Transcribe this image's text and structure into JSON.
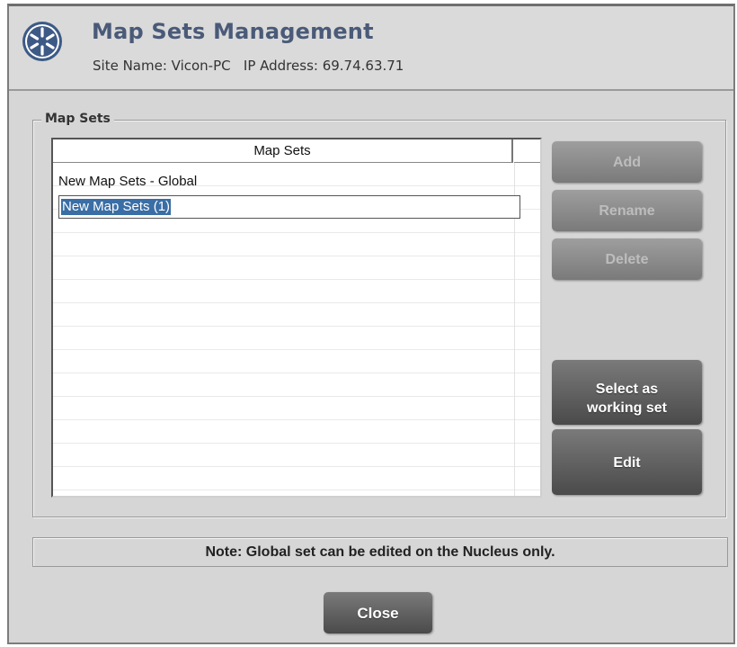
{
  "header": {
    "title": "Map Sets Management",
    "site_info": "Site Name: Vicon-PC   IP Address: 69.74.63.71",
    "logo_icon": "vicon-logo-icon"
  },
  "map_sets_group": {
    "legend": "Map Sets",
    "list": {
      "column_header": "Map Sets",
      "items": [
        "New Map Sets - Global",
        "New Map Sets (1)"
      ]
    },
    "buttons": {
      "add": "Add",
      "rename": "Rename",
      "delete": "Delete",
      "select_line1": "Select as",
      "select_line2": "working set",
      "edit": "Edit"
    }
  },
  "note": "Note: Global set can be edited on the Nucleus only.",
  "footer": {
    "close": "Close"
  },
  "colors": {
    "title": "#4a5a78",
    "logo_ring": "#3d5a86",
    "selection": "#3a6ea5"
  }
}
